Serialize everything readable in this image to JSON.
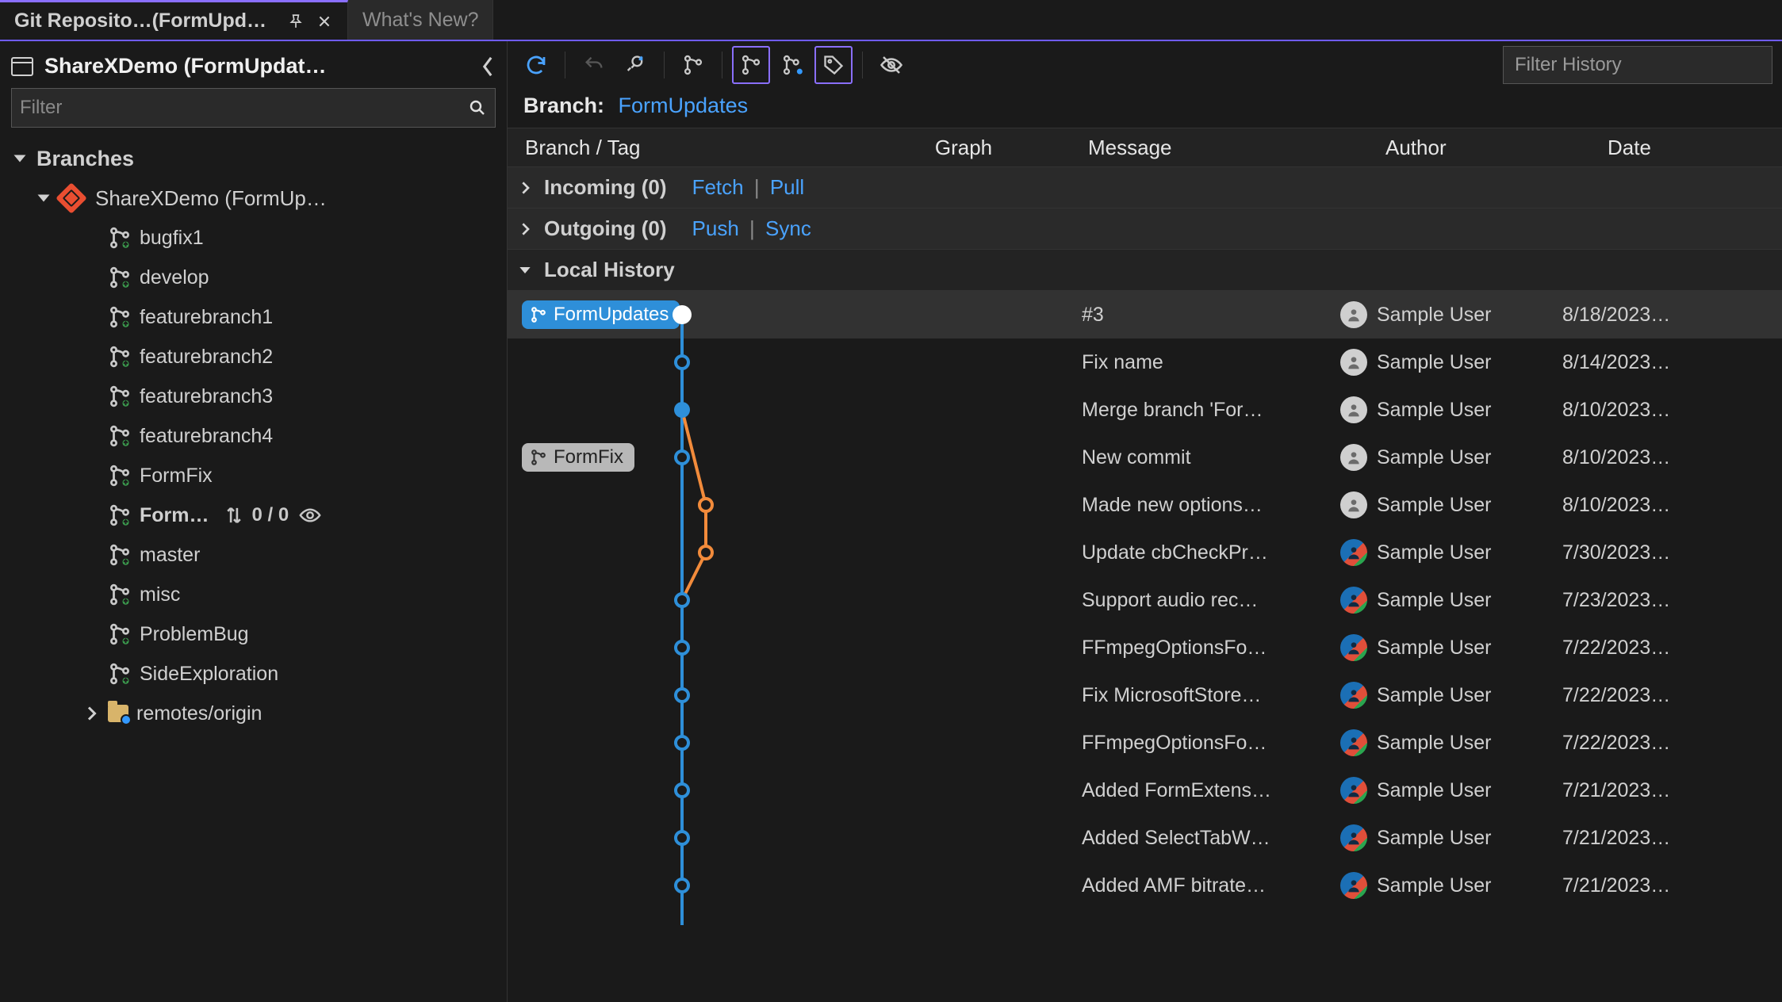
{
  "tabs": {
    "active_title": "Git Reposito…(FormUpdates)",
    "inactive_title": "What's New?"
  },
  "sidebar": {
    "repo_title": "ShareXDemo (FormUpdat…",
    "filter_placeholder": "Filter",
    "branches_label": "Branches",
    "repo_node_label": "ShareXDemo (FormUp…",
    "branches": [
      "bugfix1",
      "develop",
      "featurebranch1",
      "featurebranch2",
      "featurebranch3",
      "featurebranch4",
      "FormFix",
      "Form…",
      "master",
      "misc",
      "ProblemBug",
      "SideExploration"
    ],
    "current_branch_index": 7,
    "current_branch_counts": "0 / 0",
    "remotes_label": "remotes/origin"
  },
  "history": {
    "filter_placeholder": "Filter History",
    "branch_label": "Branch:",
    "branch_value": "FormUpdates",
    "cols": {
      "branch": "Branch / Tag",
      "graph": "Graph",
      "message": "Message",
      "author": "Author",
      "date": "Date"
    },
    "incoming": {
      "title": "Incoming (0)",
      "link1": "Fetch",
      "link2": "Pull"
    },
    "outgoing": {
      "title": "Outgoing (0)",
      "link1": "Push",
      "link2": "Sync"
    },
    "local_history_label": "Local History",
    "commits": [
      {
        "tag": "FormUpdates",
        "tag_style": "blue",
        "message": "#3",
        "author": "Sample User",
        "date": "8/18/2023…",
        "avatar": "gray",
        "node": "white",
        "lane": 0
      },
      {
        "tag": "",
        "tag_style": "",
        "message": "Fix name",
        "author": "Sample User",
        "date": "8/14/2023…",
        "avatar": "gray",
        "node": "blue",
        "lane": 0
      },
      {
        "tag": "",
        "tag_style": "",
        "message": "Merge branch 'For…",
        "author": "Sample User",
        "date": "8/10/2023…",
        "avatar": "gray",
        "node": "bluefill",
        "lane": 0
      },
      {
        "tag": "FormFix",
        "tag_style": "gray",
        "message": "New commit",
        "author": "Sample User",
        "date": "8/10/2023…",
        "avatar": "gray",
        "node": "blue",
        "lane": 0
      },
      {
        "tag": "",
        "tag_style": "",
        "message": "Made new options…",
        "author": "Sample User",
        "date": "8/10/2023…",
        "avatar": "gray",
        "node": "orange",
        "lane": 1
      },
      {
        "tag": "",
        "tag_style": "",
        "message": "Update cbCheckPr…",
        "author": "Sample User",
        "date": "7/30/2023…",
        "avatar": "color",
        "node": "orange",
        "lane": 1
      },
      {
        "tag": "",
        "tag_style": "",
        "message": "Support audio rec…",
        "author": "Sample User",
        "date": "7/23/2023…",
        "avatar": "color",
        "node": "blue",
        "lane": 0
      },
      {
        "tag": "",
        "tag_style": "",
        "message": "FFmpegOptionsFo…",
        "author": "Sample User",
        "date": "7/22/2023…",
        "avatar": "color",
        "node": "blue",
        "lane": 0
      },
      {
        "tag": "",
        "tag_style": "",
        "message": "Fix MicrosoftStore…",
        "author": "Sample User",
        "date": "7/22/2023…",
        "avatar": "color",
        "node": "blue",
        "lane": 0
      },
      {
        "tag": "",
        "tag_style": "",
        "message": "FFmpegOptionsFo…",
        "author": "Sample User",
        "date": "7/22/2023…",
        "avatar": "color",
        "node": "blue",
        "lane": 0
      },
      {
        "tag": "",
        "tag_style": "",
        "message": "Added FormExtens…",
        "author": "Sample User",
        "date": "7/21/2023…",
        "avatar": "color",
        "node": "blue",
        "lane": 0
      },
      {
        "tag": "",
        "tag_style": "",
        "message": "Added SelectTabW…",
        "author": "Sample User",
        "date": "7/21/2023…",
        "avatar": "color",
        "node": "blue",
        "lane": 0
      },
      {
        "tag": "",
        "tag_style": "",
        "message": "Added AMF bitrate…",
        "author": "Sample User",
        "date": "7/21/2023…",
        "avatar": "color",
        "node": "blue",
        "lane": 0
      }
    ]
  },
  "colors": {
    "accent": "#8a6fff",
    "link": "#4aa3ff",
    "blue": "#2e8fd9",
    "orange": "#f28b3b"
  }
}
